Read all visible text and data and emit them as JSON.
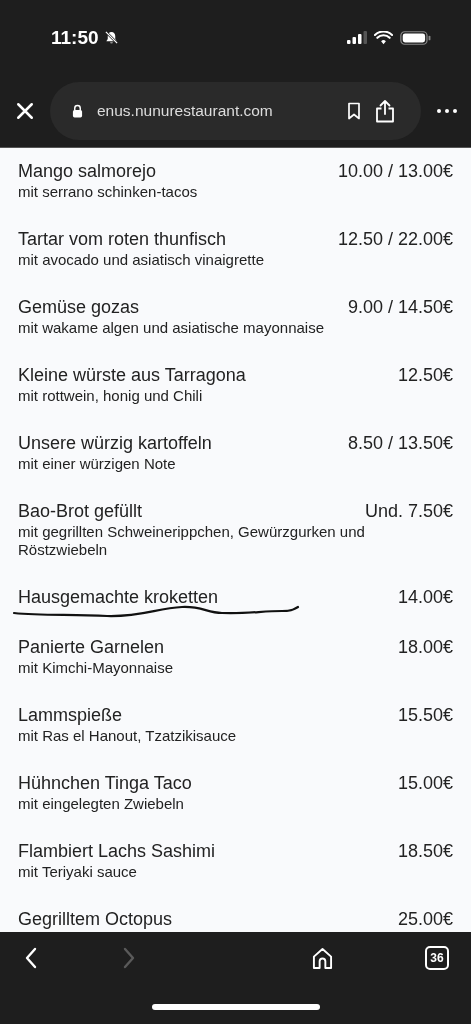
{
  "status_bar": {
    "time": "11:50",
    "silent": true
  },
  "address_bar": {
    "url": "enus.nunurestaurant.com"
  },
  "menu_items": [
    {
      "name": "Mango salmorejo",
      "price": "10.00 / 13.00€",
      "description": "mit serrano schinken-tacos",
      "scribbled": false
    },
    {
      "name": "Tartar vom roten thunfisch",
      "price": "12.50 / 22.00€",
      "description": "mit avocado und asiatisch vinaigrette",
      "scribbled": false
    },
    {
      "name": "Gemüse gozas",
      "price": "9.00 / 14.50€",
      "description": "mit wakame algen und asiatische mayonnaise",
      "scribbled": false
    },
    {
      "name": "Kleine würste aus Tarragona",
      "price": "12.50€",
      "description": "mit rottwein, honig und Chili",
      "scribbled": false
    },
    {
      "name": "Unsere würzig kartoffeln",
      "price": "8.50 / 13.50€",
      "description": "mit einer würzigen Note",
      "scribbled": false
    },
    {
      "name": "Bao-Brot gefüllt",
      "price": "Und. 7.50€",
      "description": "mit gegrillten Schweinerippchen, Gewürzgurken und Röstzwiebeln",
      "scribbled": false
    },
    {
      "name": "Hausgemachte kroketten",
      "price": "14.00€",
      "scribbled": true
    },
    {
      "name": "Panierte Garnelen",
      "price": "18.00€",
      "description": "mit Kimchi-Mayonnaise",
      "scribbled": false
    },
    {
      "name": "Lammspieße",
      "price": "15.50€",
      "description": "mit Ras el Hanout, Tzatzikisauce",
      "scribbled": false
    },
    {
      "name": "Hühnchen Tinga Taco",
      "price": "15.00€",
      "description": "mit eingelegten Zwiebeln",
      "scribbled": false
    },
    {
      "name": "Flambiert Lachs Sashimi",
      "price": "18.50€",
      "description": "mit Teriyaki sauce",
      "scribbled": false
    },
    {
      "name": "Gegrilltem Octopus",
      "price": "25.00€",
      "scribbled": false
    }
  ],
  "toolbar": {
    "forward_disabled": true,
    "tab_count": "36"
  }
}
